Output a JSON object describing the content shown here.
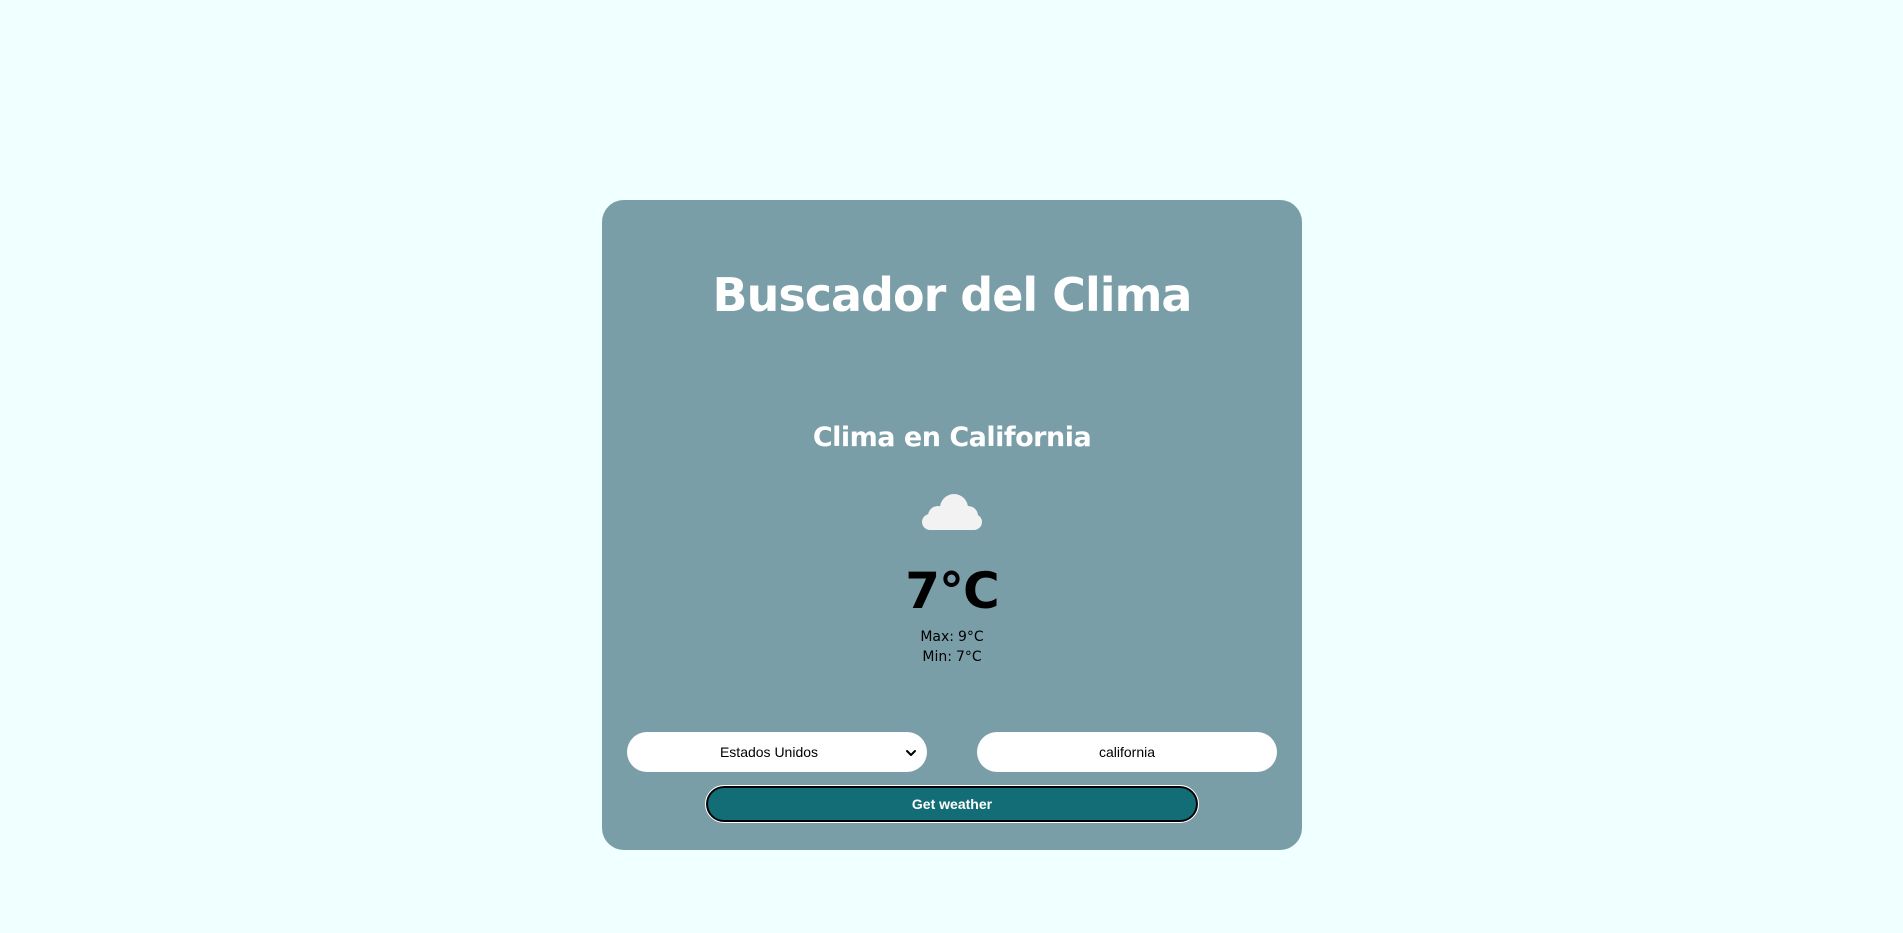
{
  "app": {
    "title": "Buscador del Clima"
  },
  "weather": {
    "heading": "Clima en California",
    "icon": "cloud-icon",
    "temperature": "7°C",
    "max_label": "Max:",
    "max_value": "9°C",
    "min_label": "Min:",
    "min_value": "7°C"
  },
  "form": {
    "country_select": {
      "selected": "Estados Unidos"
    },
    "city_input": {
      "value": "california"
    },
    "submit_label": "Get weather"
  },
  "colors": {
    "page_background": "#f0ffff",
    "card_background": "#7a9ea7",
    "button_background": "#136d76",
    "cloud": "#f2f2f2",
    "heading_text": "#ffffff"
  }
}
